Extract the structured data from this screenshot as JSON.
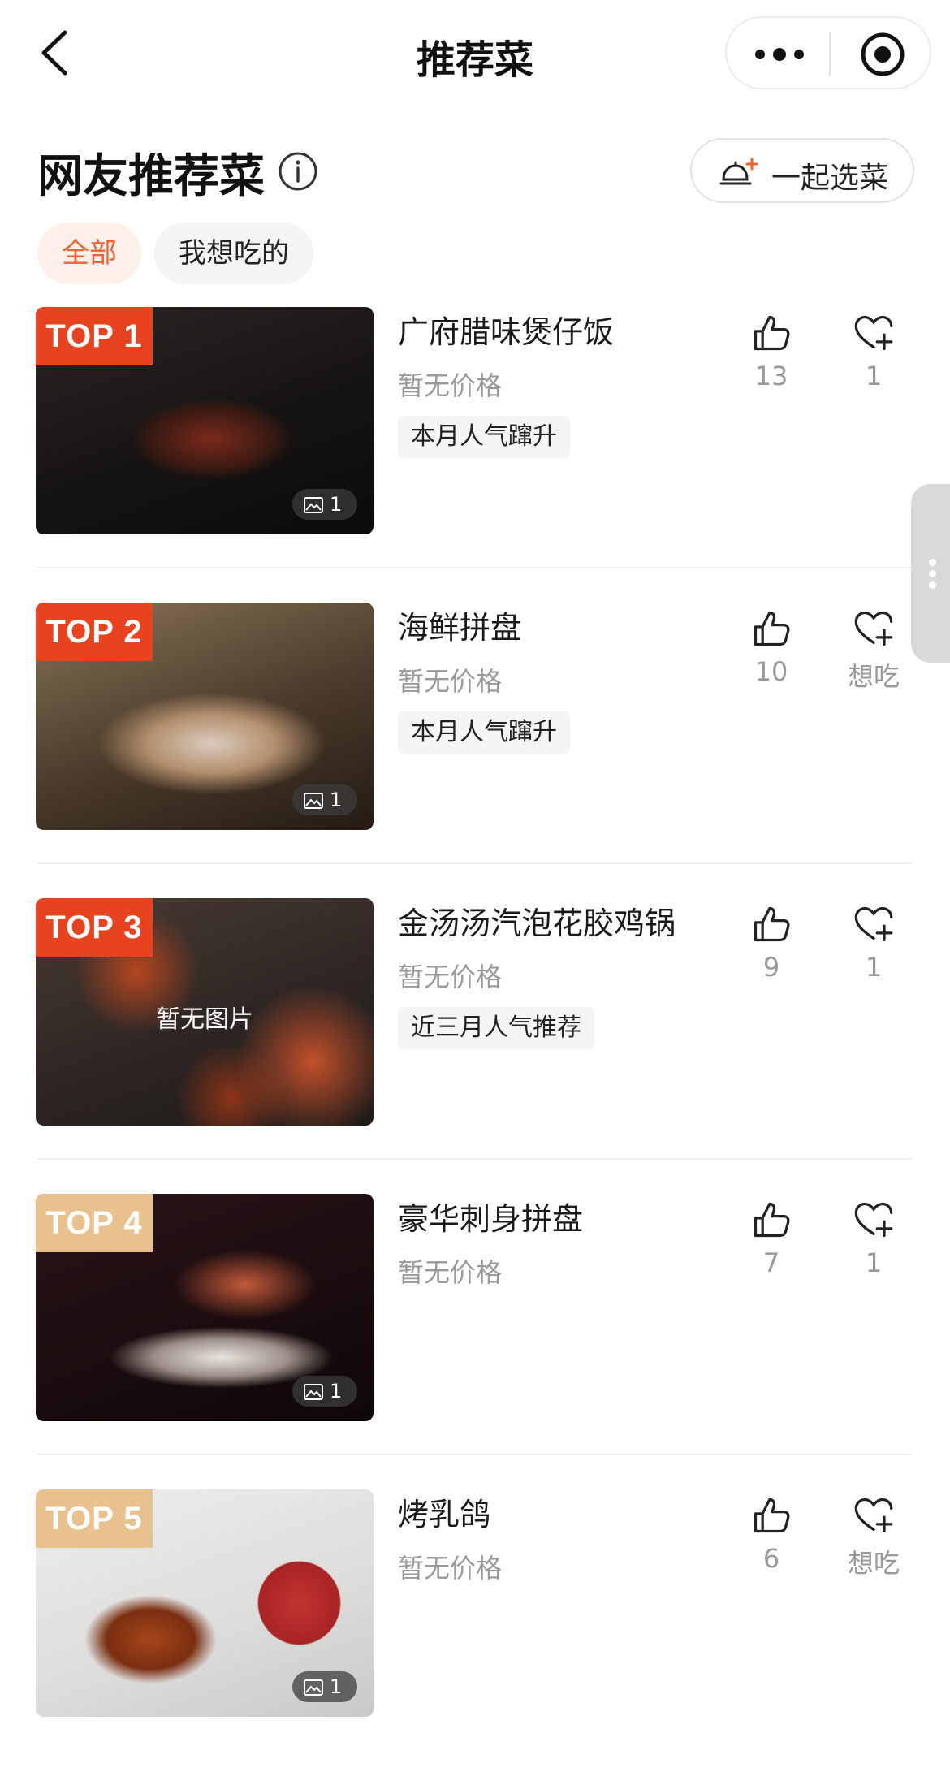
{
  "nav": {
    "title": "推荐菜"
  },
  "header": {
    "title": "网友推荐菜",
    "together_label": "一起选菜"
  },
  "tabs": [
    {
      "label": "全部",
      "active": true
    },
    {
      "label": "我想吃的",
      "active": false
    }
  ],
  "colors": {
    "accent": "#f0622f",
    "top_badge_red": "#e8431e",
    "top_badge_gold": "#e8c18f"
  },
  "dishes": [
    {
      "rank": "TOP 1",
      "name": "广府腊味煲仔饭",
      "price": "暂无价格",
      "tag": "本月人气蹿升",
      "likes": "13",
      "want": "1",
      "image_count": "1"
    },
    {
      "rank": "TOP 2",
      "name": "海鲜拼盘",
      "price": "暂无价格",
      "tag": "本月人气蹿升",
      "likes": "10",
      "want": "想吃",
      "image_count": "1"
    },
    {
      "rank": "TOP 3",
      "name": "金汤汤汽泡花胶鸡锅",
      "price": "暂无价格",
      "tag": "近三月人气推荐",
      "likes": "9",
      "want": "1",
      "no_image": "暂无图片"
    },
    {
      "rank": "TOP 4",
      "name": "豪华刺身拼盘",
      "price": "暂无价格",
      "likes": "7",
      "want": "1",
      "image_count": "1"
    },
    {
      "rank": "TOP 5",
      "name": "烤乳鸽",
      "price": "暂无价格",
      "likes": "6",
      "want": "想吃",
      "image_count": "1"
    }
  ]
}
